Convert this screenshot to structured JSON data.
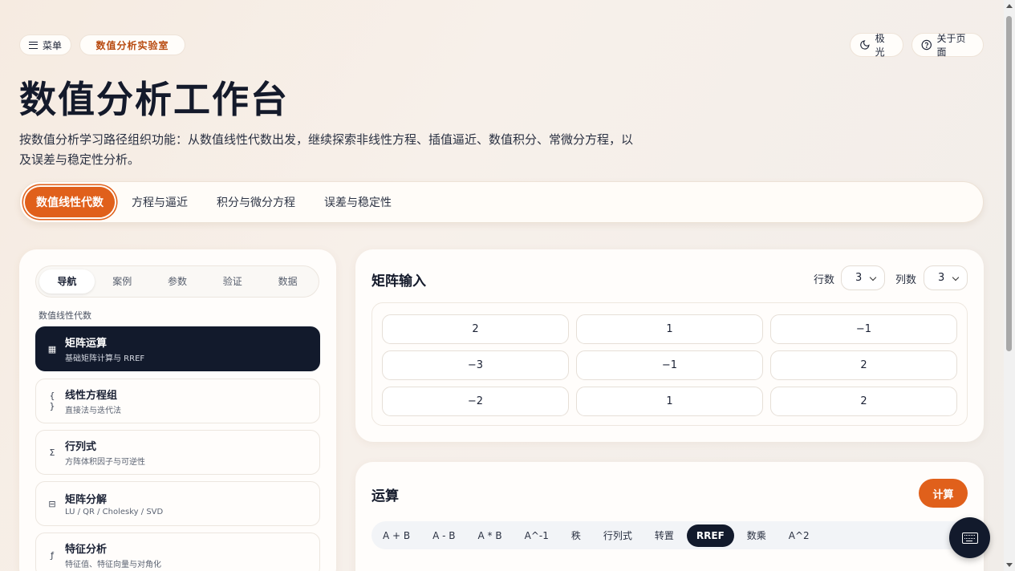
{
  "header": {
    "menu_label": "菜单",
    "lab_label": "数值分析实验室",
    "theme_label": "极光",
    "about_label": "关于页面",
    "title": "数值分析工作台",
    "subtitle": "按数值分析学习路径组织功能：从数值线性代数出发，继续探索非线性方程、插值逼近、数值积分、常微分方程，以及误差与稳定性分析。"
  },
  "tabs": [
    "数值线性代数",
    "方程与逼近",
    "积分与微分方程",
    "误差与稳定性"
  ],
  "sidebar": {
    "segments": [
      "导航",
      "案例",
      "参数",
      "验证",
      "数据"
    ],
    "section_label": "数值线性代数",
    "items": [
      {
        "title": "矩阵运算",
        "sub": "基础矩阵计算与 RREF",
        "icon": "calculator-icon",
        "glyph": "▦"
      },
      {
        "title": "线性方程组",
        "sub": "直接法与迭代法",
        "icon": "braces-icon",
        "glyph": "{ }"
      },
      {
        "title": "行列式",
        "sub": "方阵体积因子与可逆性",
        "icon": "sigma-icon",
        "glyph": "Σ"
      },
      {
        "title": "矩阵分解",
        "sub": "LU / QR / Cholesky / SVD",
        "icon": "split-icon",
        "glyph": "⊟"
      },
      {
        "title": "特征分析",
        "sub": "特征值、特征向量与对角化",
        "icon": "function-icon",
        "glyph": "ƒ"
      }
    ]
  },
  "matrix_card": {
    "title": "矩阵输入",
    "rows_label": "行数",
    "rows_value": "3",
    "cols_label": "列数",
    "cols_value": "3",
    "values": [
      [
        "2",
        "1",
        "−1"
      ],
      [
        "−3",
        "−1",
        "2"
      ],
      [
        "−2",
        "1",
        "2"
      ]
    ]
  },
  "ops_card": {
    "title": "运算",
    "compute_label": "计算",
    "operations": [
      "A + B",
      "A - B",
      "A * B",
      "A^-1",
      "秩",
      "行列式",
      "转置",
      "RREF",
      "数乘",
      "A^2"
    ],
    "active_operation": "RREF"
  },
  "colors": {
    "accent": "#e0601b",
    "dark": "#121a2c"
  }
}
